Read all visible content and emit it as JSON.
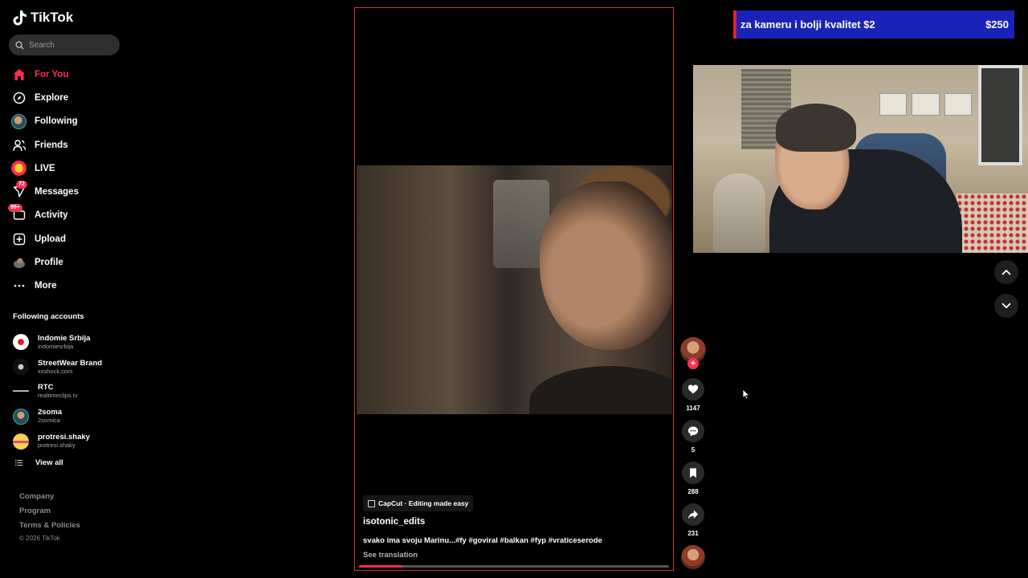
{
  "app": {
    "name": "TikTok"
  },
  "search": {
    "placeholder": "Search"
  },
  "nav": {
    "items": [
      {
        "label": "For You",
        "icon": "home-icon",
        "active": true
      },
      {
        "label": "Explore",
        "icon": "compass-icon"
      },
      {
        "label": "Following",
        "icon": "following-avatar"
      },
      {
        "label": "Friends",
        "icon": "friends-icon"
      },
      {
        "label": "LIVE",
        "icon": "live-icon"
      },
      {
        "label": "Messages",
        "icon": "messages-icon",
        "badge": "72"
      },
      {
        "label": "Activity",
        "icon": "activity-icon",
        "badge": "99+"
      },
      {
        "label": "Upload",
        "icon": "upload-icon"
      },
      {
        "label": "Profile",
        "icon": "profile-avatar"
      },
      {
        "label": "More",
        "icon": "more-icon"
      }
    ]
  },
  "following": {
    "title": "Following accounts",
    "accounts": [
      {
        "name": "Indomie Srbija",
        "handle": "indomiesrbija",
        "color": "#ffffff"
      },
      {
        "name": "StreetWear Brand",
        "handle": "xxshock.com",
        "color": "#111111"
      },
      {
        "name": "RTC",
        "handle": "realtimeclips.tv",
        "color": "#000000"
      },
      {
        "name": "2soma",
        "handle": "2somica",
        "color": "#4a6b6e"
      },
      {
        "name": "protresi.shaky",
        "handle": "protresi.shaky",
        "color": "#f5d64a"
      }
    ],
    "view_all": "View all"
  },
  "footer": {
    "links": [
      "Company",
      "Program",
      "Terms & Policies"
    ],
    "copyright": "© 2026 TikTok"
  },
  "video": {
    "capcut_label": "CapCut · Editing made easy",
    "author": "isotonic_edits",
    "description": "svako ima svoju Marinu...#fy #goviral #balkan #fyp #vraticeserode",
    "see_translation": "See translation",
    "progress": 0.14
  },
  "actions": {
    "likes": "1147",
    "comments": "5",
    "saves": "288",
    "shares": "231",
    "follow_symbol": "+"
  },
  "donation": {
    "message": "za kameru i bolji kvalitet  $2",
    "total": "$250"
  },
  "colors": {
    "accent": "#fe2c55",
    "donation_bg": "#1a23b8",
    "video_border": "#c5393d"
  }
}
